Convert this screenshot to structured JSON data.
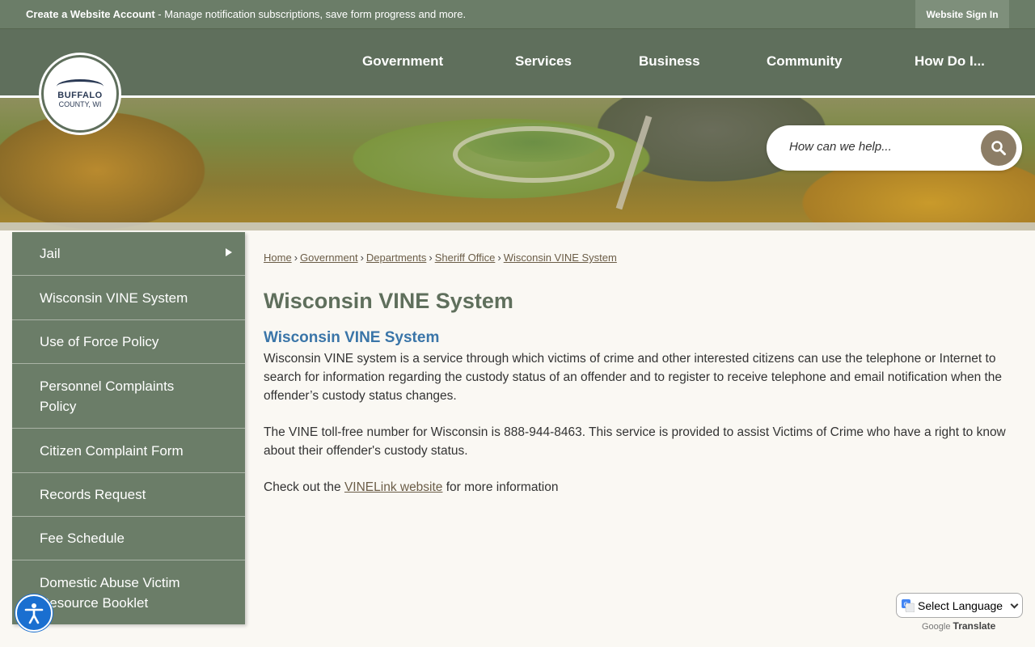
{
  "topbar": {
    "message_bold": "Create a Website Account",
    "message_rest": " - Manage notification subscriptions, save form progress and more.",
    "signin_label": "Website Sign In"
  },
  "nav": {
    "items": [
      "Government",
      "Services",
      "Business",
      "Community",
      "How Do I..."
    ]
  },
  "logo": {
    "line1": "BUFFALO",
    "line2": "COUNTY, WI"
  },
  "search": {
    "placeholder": "How can we help..."
  },
  "sidebar": {
    "items": [
      {
        "label": "Jail"
      },
      {
        "label": "Wisconsin VINE System"
      },
      {
        "label": "Use of Force Policy"
      },
      {
        "label": "Personnel Complaints Policy"
      },
      {
        "label": "Citizen Complaint Form"
      },
      {
        "label": "Records Request"
      },
      {
        "label": "Fee Schedule"
      },
      {
        "label": "Domestic Abuse Victim Resource Booklet"
      }
    ]
  },
  "breadcrumb": {
    "items": [
      "Home",
      "Government",
      "Departments",
      "Sheriff Office",
      "Wisconsin VINE System"
    ],
    "separator": "›"
  },
  "content": {
    "title": "Wisconsin VINE System",
    "subheading": "Wisconsin VINE System",
    "para1": "Wisconsin VINE system is a service through which victims of crime and other interested citizens can use the telephone or Internet to search for information regarding the custody status of an offender and to register to receive telephone and email notification when the offender’s custody status changes.",
    "para2": "The VINE toll-free number for Wisconsin is 888-944-8463. This service is provided to assist Victims of Crime who have a right to know about their offender's custody status.",
    "para3_before": "Check out the ",
    "para3_link": "VINELink website",
    "para3_after": " for more information"
  },
  "translate": {
    "select_label": "Select Language",
    "powered_google": "Google",
    "powered_translate": "Translate"
  },
  "colors": {
    "topbar": "#6b7d68",
    "nav": "#5f6f5c",
    "accent_link": "#3a75a8",
    "search_button": "#8c7d66"
  }
}
